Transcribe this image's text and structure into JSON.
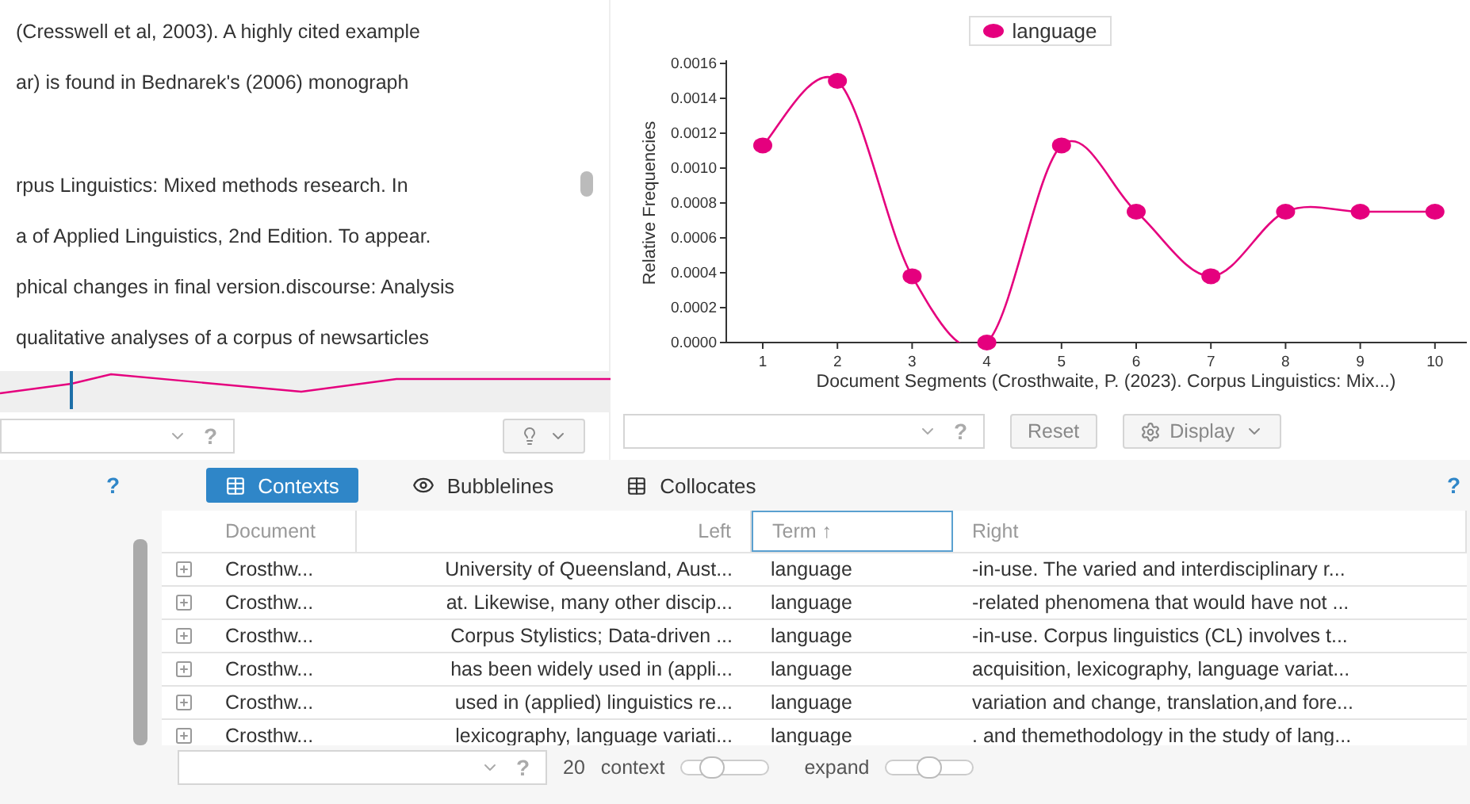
{
  "reader": {
    "paragraphs": [
      {
        "lines": [
          "(Cresswell et al, 2003). A highly cited example",
          "ar) is found in Bednarek's (2006) monograph"
        ]
      },
      {
        "lines": [
          "rpus Linguistics: Mixed methods research. In",
          "a of Applied Linguistics, 2nd Edition. To appear.",
          "phical changes in final version.discourse: Analysis",
          "qualitative analyses of a corpus of newsarticles"
        ]
      }
    ],
    "toolbar": {
      "help": "?"
    }
  },
  "trends": {
    "chart_data": {
      "type": "line",
      "xlabel": "Document Segments (Crosthwaite, P. (2023). Corpus Linguistics: Mix...)",
      "ylabel": "Relative Frequencies",
      "categories": [
        "1",
        "2",
        "3",
        "4",
        "5",
        "6",
        "7",
        "8",
        "9",
        "10"
      ],
      "series": [
        {
          "name": "language",
          "color": "#e5007e",
          "marker": true,
          "values": [
            0.00113,
            0.0015,
            0.00038,
            0,
            0.00113,
            0.00075,
            0.00038,
            0.00075,
            0.00075,
            0.00075
          ]
        }
      ],
      "ylim": [
        0,
        0.0016
      ],
      "yticks": [
        {
          "value": 0,
          "label": "0.0000"
        },
        {
          "value": 0.0002,
          "label": "0.0002"
        },
        {
          "value": 0.0004,
          "label": "0.0004"
        },
        {
          "value": 0.0006,
          "label": "0.0006"
        },
        {
          "value": 0.0008,
          "label": "0.0008"
        },
        {
          "value": 0.001,
          "label": "0.0010"
        },
        {
          "value": 0.0012,
          "label": "0.0012"
        },
        {
          "value": 0.0014,
          "label": "0.0014"
        },
        {
          "value": 0.0016,
          "label": "0.0016"
        }
      ]
    },
    "toolbar": {
      "help": "?",
      "reset": "Reset",
      "display": "Display"
    }
  },
  "corpus": {
    "help": "?",
    "right_help": "?",
    "tabs": [
      {
        "label": "Contexts",
        "kind": "grid",
        "selected": true
      },
      {
        "label": "Bubblelines",
        "kind": "eye",
        "selected": false
      },
      {
        "label": "Collocates",
        "kind": "grid",
        "selected": false
      }
    ],
    "table": {
      "columns": [
        {
          "label": "Document",
          "sorted": false
        },
        {
          "label": "Left",
          "sorted": false
        },
        {
          "label": "Term ↑",
          "sorted": true
        },
        {
          "label": "Right",
          "sorted": false
        }
      ],
      "rows": [
        {
          "document": "Crosthw...",
          "left": "University of Queensland, Aust...",
          "term": "language",
          "right": "-in-use. The varied and interdisciplinary r..."
        },
        {
          "document": "Crosthw...",
          "left": "at. Likewise, many other discip...",
          "term": "language",
          "right": "-related phenomena that would have not ..."
        },
        {
          "document": "Crosthw...",
          "left": "Corpus Stylistics; Data-driven ...",
          "term": "language",
          "right": "-in-use. Corpus linguistics (CL) involves t..."
        },
        {
          "document": "Crosthw...",
          "left": "has been widely used in (appli...",
          "term": "language",
          "right": "acquisition, lexicography, language variat..."
        },
        {
          "document": "Crosthw...",
          "left": "used in (applied) linguistics re...",
          "term": "language",
          "right": "variation and change, translation,and fore..."
        },
        {
          "document": "Crosthw...",
          "left": "lexicography, language variati...",
          "term": "language",
          "right": ". and themethodology in the study of lang..."
        }
      ]
    },
    "footer": {
      "help": "?",
      "count": "20",
      "context_label": "context",
      "context": {
        "level": 0.35
      },
      "expand_label": "expand",
      "expand": {
        "level": 0.5
      }
    }
  }
}
